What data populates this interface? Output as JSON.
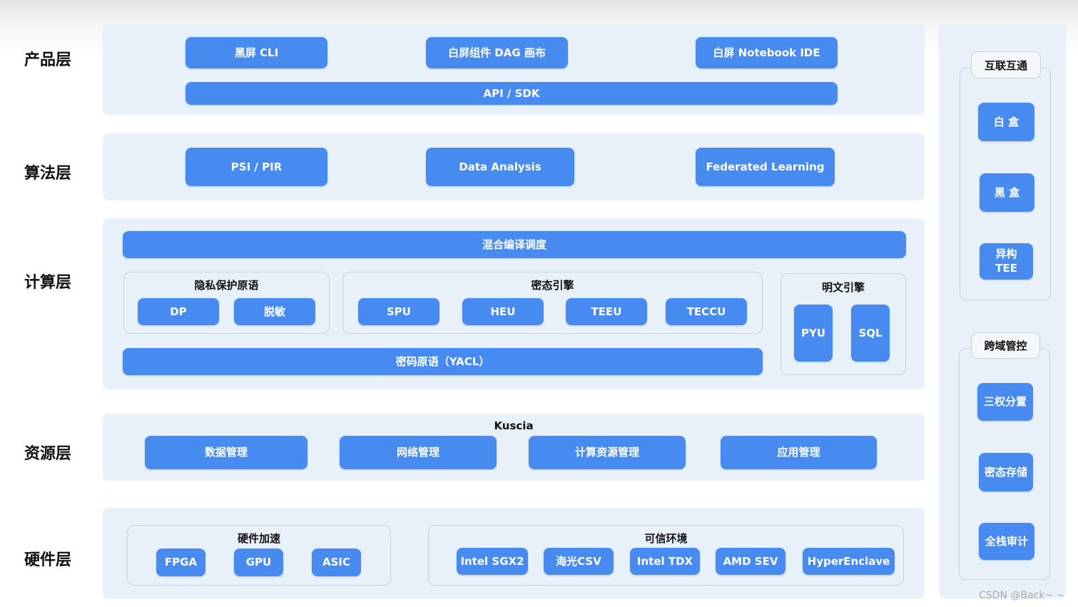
{
  "layers": [
    "产品层",
    "算法层",
    "计算层",
    "资源层",
    "硬件层"
  ],
  "product": {
    "buttons": [
      "黑屏 CLI",
      "白屏组件 DAG 画布",
      "白屏 Notebook IDE"
    ],
    "api": "API / SDK"
  },
  "algorithm": {
    "buttons": [
      "PSI / PIR",
      "Data Analysis",
      "Federated Learning"
    ]
  },
  "compute": {
    "scheduler": "混合编译调度",
    "privacy": {
      "title": "隐私保护原语",
      "items": [
        "DP",
        "脱敏"
      ]
    },
    "cipher": {
      "title": "密态引擎",
      "items": [
        "SPU",
        "HEU",
        "TEEU",
        "TECCU"
      ]
    },
    "plain": {
      "title": "明文引擎",
      "items": [
        "PYU",
        "SQL"
      ]
    },
    "yacl": "密码原语（YACL）"
  },
  "resource": {
    "title": "Kuscia",
    "items": [
      "数据管理",
      "网络管理",
      "计算资源管理",
      "应用管理"
    ]
  },
  "hardware": {
    "accel": {
      "title": "硬件加速",
      "items": [
        "FPGA",
        "GPU",
        "ASIC"
      ]
    },
    "trusted": {
      "title": "可信环境",
      "items": [
        "Intel SGX2",
        "海光CSV",
        "Intel TDX",
        "AMD SEV",
        "HyperEnclave"
      ]
    }
  },
  "side": {
    "interop": {
      "title": "互联互通",
      "items": [
        "白 盒",
        "黑 盒",
        "异构\nTEE"
      ]
    },
    "control": {
      "title": "跨域管控",
      "items": [
        "三权分置",
        "密态存储",
        "全栈审计"
      ]
    }
  },
  "watermark": "CSDN @Back~ ~",
  "colors": {
    "button": "#478bf0",
    "panel": "#e8f0fa"
  }
}
